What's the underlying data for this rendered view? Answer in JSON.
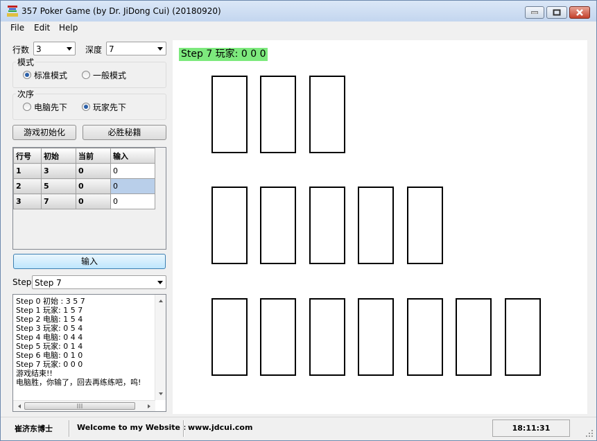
{
  "window": {
    "title": "357 Poker Game (by Dr. JiDong Cui) (20180920)"
  },
  "menu": {
    "items": [
      "File",
      "Edit",
      "Help"
    ]
  },
  "settings": {
    "rows_label": "行数",
    "rows_value": "3",
    "depth_label": "深度",
    "depth_value": "7"
  },
  "mode_group": {
    "title": "模式",
    "options": [
      "标准模式",
      "一般模式"
    ],
    "selected": "标准模式"
  },
  "order_group": {
    "title": "次序",
    "options": [
      "电脑先下",
      "玩家先下"
    ],
    "selected": "玩家先下"
  },
  "buttons": {
    "init": "游戏初始化",
    "secret": "必胜秘籍",
    "input": "输入"
  },
  "grid": {
    "headers": [
      "行号",
      "初始",
      "当前",
      "输入"
    ],
    "rows": [
      [
        "1",
        "3",
        "0",
        "0"
      ],
      [
        "2",
        "5",
        "0",
        "0"
      ],
      [
        "3",
        "7",
        "0",
        "0"
      ]
    ],
    "selected_row": 2
  },
  "step": {
    "label": "Step",
    "value": "Step 7"
  },
  "log": {
    "lines": [
      "Step 0 初始 : 3 5 7",
      "Step 1 玩家: 1 5 7",
      "Step 2 电脑: 1 5 4",
      "Step 3 玩家: 0 5 4",
      "Step 4 电脑: 0 4 4",
      "Step 5 玩家: 0 1 4",
      "Step 6 电脑: 0 1 0",
      "Step 7 玩家: 0 0 0",
      "游戏结束!!",
      "电脑胜，你输了，回去再练练吧，呜!"
    ]
  },
  "board": {
    "status": "Step 7 玩家: 0 0 0",
    "card_rows": [
      3,
      5,
      7
    ]
  },
  "statusbar": {
    "author": "崔济东博士",
    "welcome": "Welcome to my Website :",
    "website": "www.jdcui.com",
    "time": "18:11:31"
  },
  "colors": {
    "status_highlight": "#7de97d",
    "selected_row": "#b9cfea"
  }
}
